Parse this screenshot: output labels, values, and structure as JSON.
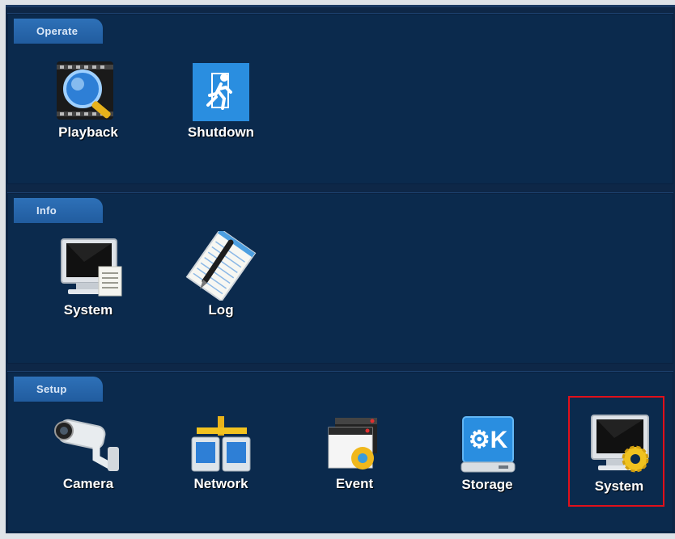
{
  "sections": {
    "operate": {
      "title": "Operate",
      "items": [
        {
          "label": "Playback",
          "icon": "playback-magnifier-icon"
        },
        {
          "label": "Shutdown",
          "icon": "exit-running-man-icon"
        }
      ]
    },
    "info": {
      "title": "Info",
      "items": [
        {
          "label": "System",
          "icon": "monitor-document-icon"
        },
        {
          "label": "Log",
          "icon": "notepad-pen-icon"
        }
      ]
    },
    "setup": {
      "title": "Setup",
      "items": [
        {
          "label": "Camera",
          "icon": "security-camera-icon"
        },
        {
          "label": "Network",
          "icon": "network-computers-icon"
        },
        {
          "label": "Event",
          "icon": "windows-gear-icon"
        },
        {
          "label": "Storage",
          "icon": "drive-k-icon"
        },
        {
          "label": "System",
          "icon": "monitor-gear-icon",
          "selected": true
        }
      ]
    }
  },
  "colors": {
    "background": "#0e2747",
    "panel": "#0b2a4d",
    "tab": "#2a6ab0",
    "selection_border": "#e0101a"
  }
}
